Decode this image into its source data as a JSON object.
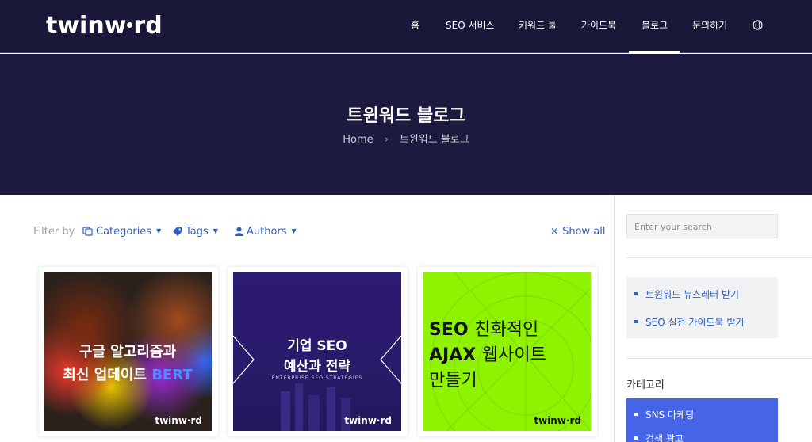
{
  "header": {
    "logo_text": "twinw",
    "logo_text_end": "rd",
    "nav": [
      "홈",
      "SEO 서비스",
      "키워드 툴",
      "가이드북",
      "블로그",
      "문의하기"
    ],
    "active_nav": "블로그",
    "language_icon": "globe-icon"
  },
  "hero": {
    "title": "트윈워드 블로그",
    "breadcrumb_home": "Home",
    "breadcrumb_sep": "›",
    "breadcrumb_current": "트윈워드 블로그"
  },
  "filter": {
    "label": "Filter by",
    "categories": "Categories",
    "tags": "Tags",
    "authors": "Authors",
    "show_all": "Show all"
  },
  "cards": [
    {
      "line1": "구글 알고리즘과",
      "line2a": "최신 업데이트 ",
      "line2b": "BERT",
      "logo": "twinw·rd"
    },
    {
      "line1": "기업 SEO",
      "line2": "예산과 전략",
      "subtitle": "ENTERPRISE SEO STRATEGIES",
      "logo": "twinw·rd"
    },
    {
      "line1a": "SEO ",
      "line1b": "친화적인",
      "line2a": "AJAX ",
      "line2b": "웹사이트",
      "line3": "만들기",
      "logo": "twinw·rd"
    }
  ],
  "sidebar": {
    "search_placeholder": "Enter your search",
    "links": [
      "트윈워드 뉴스레터 받기",
      "SEO 실전 가이드북 받기"
    ],
    "category_title": "카테고리",
    "categories": [
      "SNS 마케팅",
      "검색 광고"
    ]
  },
  "colors": {
    "header_bg": "#1a1839",
    "hero_bg": "#1c1a3e",
    "link_blue": "#2e5fbf",
    "category_bg": "#4564e6",
    "card2_bg": "#2b1a6e",
    "card3_bg": "#8ff300"
  }
}
